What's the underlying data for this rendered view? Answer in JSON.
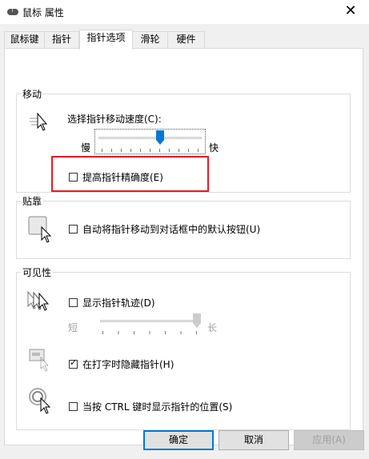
{
  "window": {
    "title": "鼠标 属性",
    "close_glyph": "✕"
  },
  "tabs": [
    {
      "label": "鼠标键"
    },
    {
      "label": "指针"
    },
    {
      "label": "指针选项"
    },
    {
      "label": "滑轮"
    },
    {
      "label": "硬件"
    }
  ],
  "motion": {
    "group_title": "移动",
    "speed_label": "选择指针移动速度(C):",
    "slow": "慢",
    "fast": "快",
    "precision_label": "提高指针精确度(E)",
    "precision_checked": false,
    "speed_level": 0.6
  },
  "snap": {
    "group_title": "贴靠",
    "label": "自动将指针移动到对话框中的默认按钮(U)",
    "checked": false
  },
  "visibility": {
    "group_title": "可见性",
    "trails_label": "显示指针轨迹(D)",
    "trails_checked": false,
    "short": "短",
    "long": "长",
    "trails_level": 1.0,
    "hide_label": "在打字时隐藏指针(H)",
    "hide_checked": true,
    "ctrl_label": "当按 CTRL 键时显示指针的位置(S)",
    "ctrl_checked": false
  },
  "buttons": {
    "ok": "确定",
    "cancel": "取消",
    "apply": "应用(A)"
  },
  "colors": {
    "accent": "#0078d7",
    "highlight_box": "#e81b23"
  }
}
